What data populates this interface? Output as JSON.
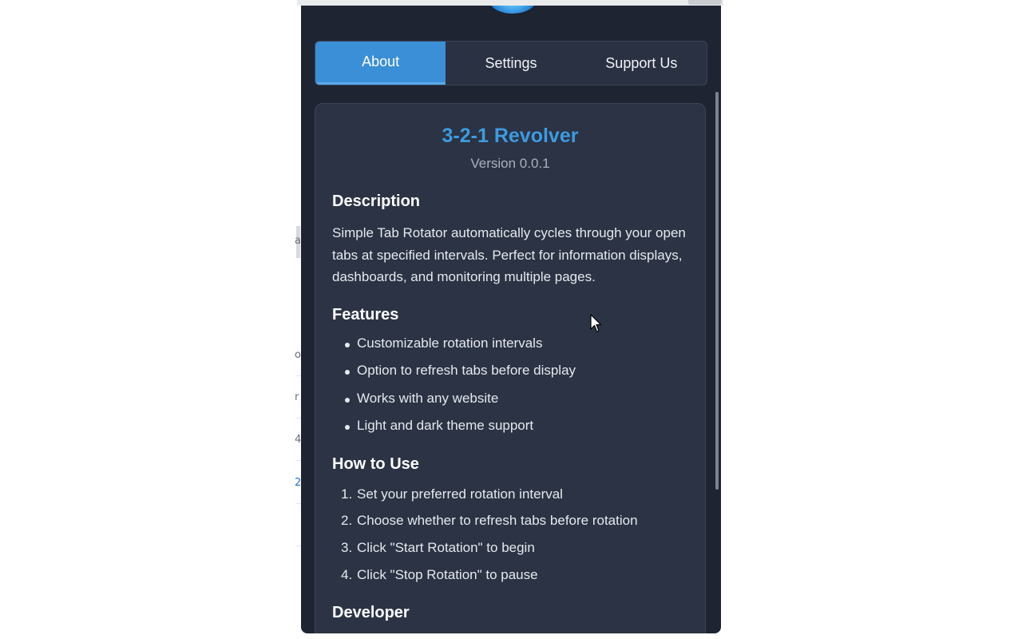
{
  "tabs": [
    {
      "label": "About",
      "active": true
    },
    {
      "label": "Settings",
      "active": false
    },
    {
      "label": "Support Us",
      "active": false
    }
  ],
  "about": {
    "title": "3-2-1 Revolver",
    "version": "Version 0.0.1",
    "description_heading": "Description",
    "description": "Simple Tab Rotator automatically cycles through your open tabs at specified intervals. Perfect for information displays, dashboards, and monitoring multiple pages.",
    "features_heading": "Features",
    "features": [
      "Customizable rotation intervals",
      "Option to refresh tabs before display",
      "Works with any website",
      "Light and dark theme support"
    ],
    "howto_heading": "How to Use",
    "howto": [
      "Set your preferred rotation interval",
      "Choose whether to refresh tabs before rotation",
      "Click \"Start Rotation\" to begin",
      "Click \"Stop Rotation\" to pause"
    ],
    "developer_heading": "Developer"
  },
  "background_page": {
    "fragments": [
      "a",
      "o",
      "r",
      "4",
      "2"
    ]
  },
  "icons": {
    "logo": "revolver-logo-icon",
    "cursor": "mouse-pointer-icon"
  },
  "colors": {
    "accent": "#3b8fd6",
    "title": "#3d9be0",
    "popup_bg": "#1e2432",
    "card_bg": "#2b3344"
  }
}
